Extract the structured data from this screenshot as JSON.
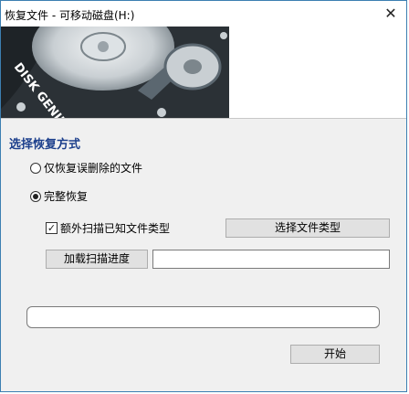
{
  "window": {
    "title": "恢复文件 - 可移动磁盘(H:)",
    "close_glyph": "✕"
  },
  "banner": {
    "logo_text": "DISK GENIUS",
    "logo_colors": {
      "dark": "#2b3136",
      "mid": "#5b6770",
      "light": "#c9cfd3"
    }
  },
  "recovery_mode": {
    "section_title": "选择恢复方式",
    "options": [
      {
        "label": "仅恢复误删除的文件",
        "selected": false
      },
      {
        "label": "完整恢复",
        "selected": true
      }
    ]
  },
  "extra_scan": {
    "checkbox_label": "额外扫描已知文件类型",
    "checked": true,
    "check_glyph": "✓",
    "select_types_button": "选择文件类型"
  },
  "scan_progress": {
    "load_button": "加载扫描进度",
    "path_value": ""
  },
  "progress": {
    "value": 0
  },
  "start_button": "开始",
  "colors": {
    "section_title": "#1c3f8c",
    "window_border": "#3c7fb1"
  }
}
